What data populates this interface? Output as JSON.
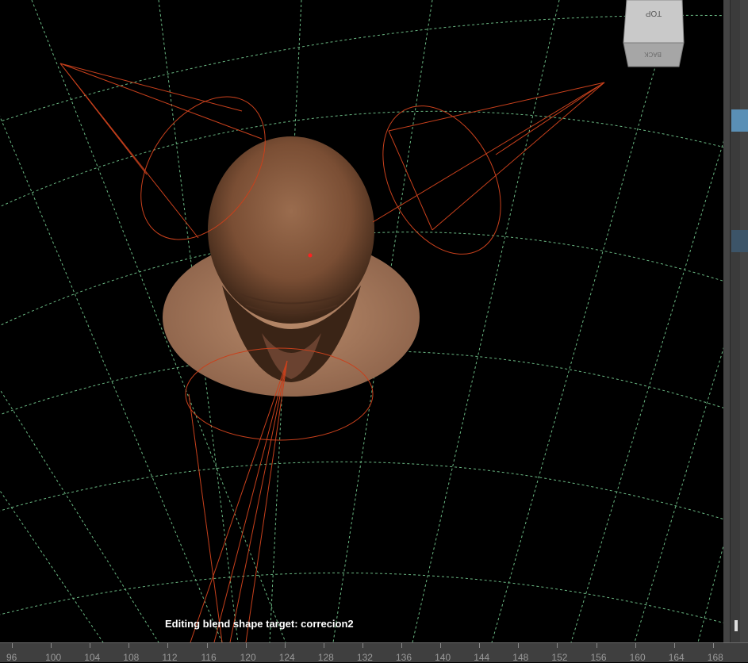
{
  "viewport": {
    "status_text": "Editing blend shape target: correcion2",
    "viewcube": {
      "top_label": "TOP",
      "side_label": "BACK"
    },
    "colors": {
      "grid": "#7dd99a",
      "light": "#c8401c",
      "background": "#000000"
    }
  },
  "right_panel": {
    "accent": "#5a8fb5",
    "accent2": "#3c5468"
  },
  "timeline": {
    "ticks": [
      "96",
      "100",
      "104",
      "108",
      "112",
      "116",
      "120",
      "124",
      "128",
      "132",
      "136",
      "140",
      "144",
      "148",
      "152",
      "156",
      "160",
      "164",
      "168"
    ]
  }
}
